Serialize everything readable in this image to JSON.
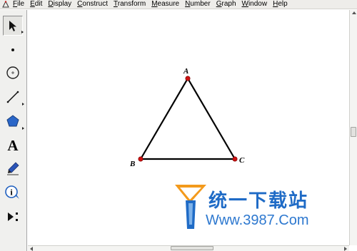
{
  "menubar": {
    "items": [
      "File",
      "Edit",
      "Display",
      "Construct",
      "Transform",
      "Measure",
      "Number",
      "Graph",
      "Window",
      "Help"
    ]
  },
  "toolbox": {
    "tools": [
      {
        "name": "selection-arrow-tool",
        "icon": "arrow-pointer-icon",
        "selected": true
      },
      {
        "name": "point-tool",
        "icon": "point-icon"
      },
      {
        "name": "compass-tool",
        "icon": "circle-icon"
      },
      {
        "name": "straightedge-tool",
        "icon": "line-segment-icon"
      },
      {
        "name": "polygon-tool",
        "icon": "pentagon-icon"
      },
      {
        "name": "text-tool",
        "icon": "text-a-icon",
        "glyph": "A"
      },
      {
        "name": "marker-tool",
        "icon": "pen-icon"
      },
      {
        "name": "information-tool",
        "icon": "info-icon",
        "glyph": "i"
      },
      {
        "name": "custom-tool",
        "icon": "play-custom-icon"
      }
    ]
  },
  "figure": {
    "vertices": [
      {
        "label": "A"
      },
      {
        "label": "B"
      },
      {
        "label": "C"
      }
    ],
    "point_color": "#cc1111",
    "segment_color": "#000000"
  },
  "watermark": {
    "chinese": "统一下载站",
    "url": "Www.3987.Com",
    "color": "#1f6bc6"
  }
}
